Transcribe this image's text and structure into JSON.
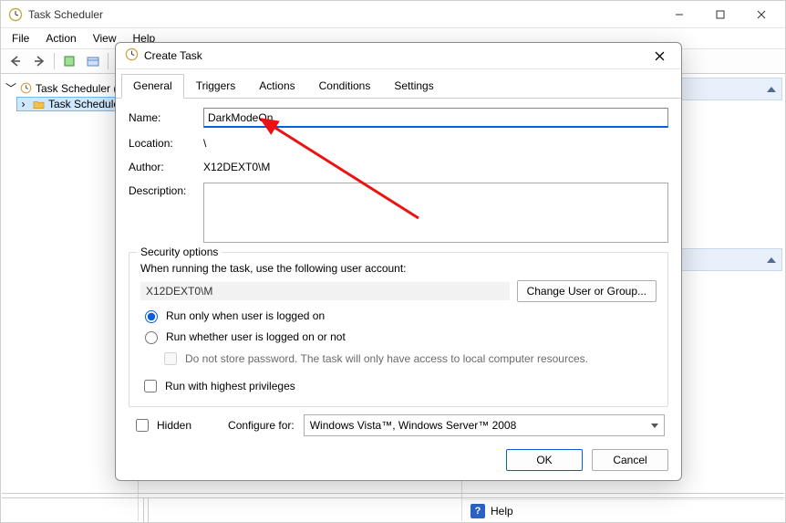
{
  "window": {
    "title": "Task Scheduler",
    "min_tooltip": "Minimize",
    "max_tooltip": "Maximize",
    "close_tooltip": "Close"
  },
  "menubar": [
    "File",
    "Action",
    "View",
    "Help"
  ],
  "tree": {
    "root": "Task Scheduler (L",
    "child": "Task Schedule"
  },
  "right_panel": {
    "help_label": "Help"
  },
  "dialog": {
    "title": "Create Task",
    "tabs": [
      "General",
      "Triggers",
      "Actions",
      "Conditions",
      "Settings"
    ],
    "active_tab": 0,
    "labels": {
      "name": "Name:",
      "location": "Location:",
      "author": "Author:",
      "description": "Description:"
    },
    "values": {
      "name": "DarkModeOn",
      "location": "\\",
      "author": "X12DEXT0\\M",
      "description": ""
    },
    "security": {
      "legend": "Security options",
      "intro": "When running the task, use the following user account:",
      "account": "X12DEXT0\\M",
      "change_btn": "Change User or Group...",
      "radio_logged_on": "Run only when user is logged on",
      "radio_any": "Run whether user is logged on or not",
      "no_store_pw": "Do not store password.  The task will only have access to local computer resources.",
      "highest_priv": "Run with highest privileges",
      "selected_radio": "logged_on",
      "no_store_pw_checked": false,
      "highest_priv_checked": false
    },
    "bottom": {
      "hidden_label": "Hidden",
      "hidden_checked": false,
      "configure_label": "Configure for:",
      "configure_value": "Windows Vista™, Windows Server™ 2008"
    },
    "buttons": {
      "ok": "OK",
      "cancel": "Cancel"
    }
  }
}
